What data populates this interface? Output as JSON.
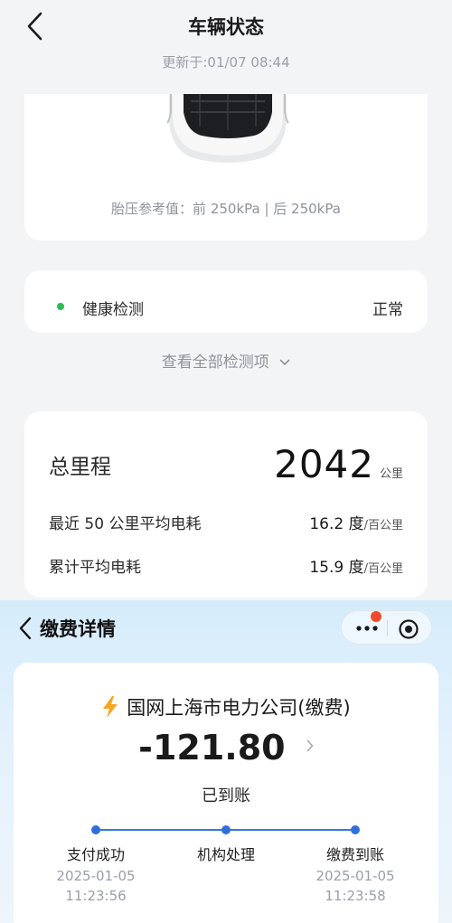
{
  "vehicle": {
    "title": "车辆状态",
    "updated": "更新于:01/07 08:44",
    "tire_pressure": "胎压参考值：前 250kPa | 后 250kPa",
    "health_label": "健康检测",
    "health_status": "正常",
    "view_all": "查看全部检测项",
    "mileage_label": "总里程",
    "mileage_value": "2042",
    "mileage_unit": "公里",
    "recent_label": "最近 50 公里平均电耗",
    "recent_value": "16.2 度",
    "recent_unit": "/百公里",
    "avg_label": "累计平均电耗",
    "avg_value": "15.9 度",
    "avg_unit": "/百公里",
    "health_dot_color": "#2dbb55"
  },
  "payment": {
    "title": "缴费详情",
    "payee": "国网上海市电力公司(缴费)",
    "amount": "-121.80",
    "status": "已到账",
    "steps": [
      {
        "label": "支付成功",
        "date": "2025-01-05",
        "time": "11:23:56"
      },
      {
        "label": "机构处理",
        "date": "",
        "time": ""
      },
      {
        "label": "缴费到账",
        "date": "2025-01-05",
        "time": "11:23:58"
      }
    ],
    "accent_color": "#2f6fdd",
    "badge_color": "#f04a2a"
  },
  "icons": [
    "back-arrow-icon",
    "car-top-view-icon",
    "chevron-down-icon",
    "lightning-bolt-icon",
    "chevron-right-icon",
    "more-dots-icon",
    "target-close-icon"
  ]
}
